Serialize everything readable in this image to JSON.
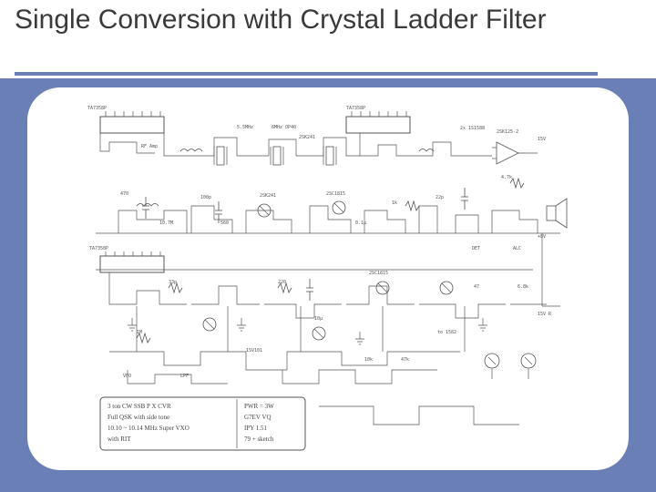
{
  "slide": {
    "title": "Single Conversion with Crystal Ladder Filter"
  },
  "schematic": {
    "ic_labels": [
      "TA7358P",
      "TA7358P",
      "TA7358P"
    ],
    "misc_labels": [
      "2SK241",
      "2SK241",
      "2x 1S1588",
      "2SK125-2",
      "15V",
      "RF Amp",
      "5.5MHz",
      "6MHz OP40",
      "DET",
      "ALC",
      "+8V",
      "470",
      "100p",
      "1M",
      "560",
      "2SC1815",
      "2SC1815",
      "0.1µ",
      "10µ",
      "1SV101",
      "VFO",
      "LPF",
      "10.7M",
      "22p",
      "33p",
      "47",
      "220",
      "1k",
      "4.7k",
      "6.8k",
      "10k",
      "47k",
      "to 1582",
      "15V R"
    ],
    "note_box": {
      "line1": "3 ton  CW  SSB P  X CVR",
      "line2": "Full QSK with side tone",
      "line3": "10.10 ~ 10.14 MHz   Super VXO",
      "line4": "with RIT",
      "right1": "PWR = 3W",
      "right2": "G7EV  VQ",
      "right3": "IPY 1.51",
      "right4": "79 + sketch"
    }
  }
}
